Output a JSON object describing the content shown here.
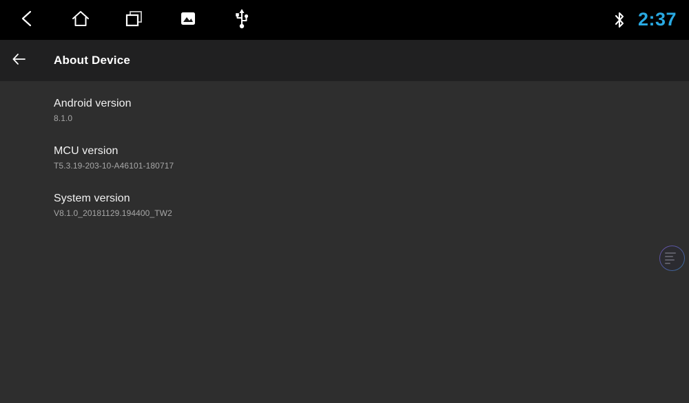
{
  "status_bar": {
    "nav_icons": [
      {
        "name": "back-icon",
        "label": "Back"
      },
      {
        "name": "home-icon",
        "label": "Home"
      },
      {
        "name": "recents-icon",
        "label": "Recent apps"
      },
      {
        "name": "screenshot-icon",
        "label": "Screenshot"
      },
      {
        "name": "usb-icon",
        "label": "USB"
      }
    ],
    "bluetooth_icon": "bluetooth-icon",
    "clock": "2:37",
    "clock_color": "#29a9e2",
    "background_color": "#000000"
  },
  "action_bar": {
    "back_icon": "arrow-left-icon",
    "title": "About Device",
    "background_color": "#202021"
  },
  "content": {
    "background_color": "#2e2e2e",
    "items": [
      {
        "label": "Android version",
        "value": "8.1.0"
      },
      {
        "label": "MCU version",
        "value": "T5.3.19-203-10-A46101-180717"
      },
      {
        "label": "System version",
        "value": "V8.1.0_20181129.194400_TW2"
      }
    ]
  },
  "floating_ball": {
    "name": "floating-assistant-ball",
    "ring_start_color": "#7e5cc6",
    "ring_end_color": "#3a80b6"
  }
}
